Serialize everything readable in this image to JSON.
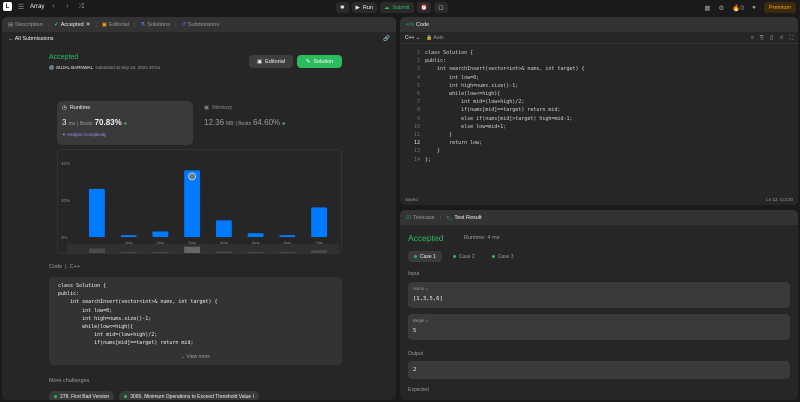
{
  "topbar": {
    "problem_list": "Array",
    "run_label": "Run",
    "submit_label": "Submit",
    "streak": "0",
    "premium_label": "Premium"
  },
  "left": {
    "tabs": [
      {
        "label": "Description"
      },
      {
        "label": "Accepted"
      },
      {
        "label": "Editorial"
      },
      {
        "label": "Solutions"
      },
      {
        "label": "Submissions"
      }
    ],
    "back_label": "All Submissions",
    "status": "Accepted",
    "author": "SUJAL BARNWAL",
    "submitted": "submitted at Sep 10, 2024 20:51",
    "editorial_btn": "Editorial",
    "solution_btn": "Solution",
    "runtime": {
      "label": "Runtime",
      "value": "3",
      "unit": "ms",
      "beats_label": "| Beats",
      "beats": "70.83%",
      "analyze": "Analyze Complexity"
    },
    "memory": {
      "label": "Memory",
      "value": "12.36",
      "unit": "MB",
      "beats_label": "| Beats",
      "beats": "64.60%"
    },
    "code_label": "Code",
    "code_lang": "C++",
    "code_lines": [
      "class Solution {",
      "public:",
      "    int searchInsert(vector<int>& nums, int target) {",
      "        int low=0;",
      "        int high=nums.size()-1;",
      "        while(low<=high){",
      "            int mid=(low+high)/2;",
      "            if(nums[mid]==target) return mid;"
    ],
    "view_more": "View more",
    "more_title": "More challenges",
    "challenges": [
      {
        "label": "278. First Bad Version",
        "level": "easy"
      },
      {
        "label": "3065. Minimum Operations to Exceed Threshold Value I",
        "level": "easy"
      }
    ]
  },
  "chart_data": {
    "type": "bar",
    "y_ticks": [
      "40%",
      "20%",
      "0%"
    ],
    "ylim": [
      0,
      40
    ],
    "categories": [
      "",
      "1ms",
      "2ms",
      "3ms",
      "4ms",
      "5ms",
      "6ms",
      "7ms"
    ],
    "values": [
      26,
      1,
      3,
      36,
      9,
      2,
      1,
      16
    ],
    "highlight_index": 3,
    "bar_color": "#007aff",
    "grid": true
  },
  "code_panel": {
    "title": "Code",
    "lang": "C++",
    "auto": "Auto",
    "lines": [
      "class Solution {",
      "public:",
      "    int searchInsert(vector<int>& nums, int target) {",
      "        int low=0;",
      "        int high=nums.size()-1;",
      "        while(low<=high){",
      "            int mid=(low+high)/2;",
      "            if(nums[mid]==target) return mid;",
      "            else if(nums[mid]>target) high=mid-1;",
      "            else low=mid+1;",
      "        }",
      "        return low;",
      "    }",
      "};"
    ],
    "saved": "Saved",
    "cursor": "Ln 12, Col 20"
  },
  "test_panel": {
    "tab_testcase": "Testcase",
    "tab_result": "Test Result",
    "status": "Accepted",
    "runtime": "Runtime: 4 ms",
    "cases": [
      "Case 1",
      "Case 2",
      "Case 3"
    ],
    "input_label": "Input",
    "nums_label": "nums =",
    "nums_value": "[1,3,5,6]",
    "target_label": "target =",
    "target_value": "5",
    "output_label": "Output",
    "output_value": "2",
    "expected_label": "Expected"
  },
  "colors": {
    "accent_green": "#2cbb5d",
    "premium": "#ffa116",
    "bar": "#007aff"
  }
}
